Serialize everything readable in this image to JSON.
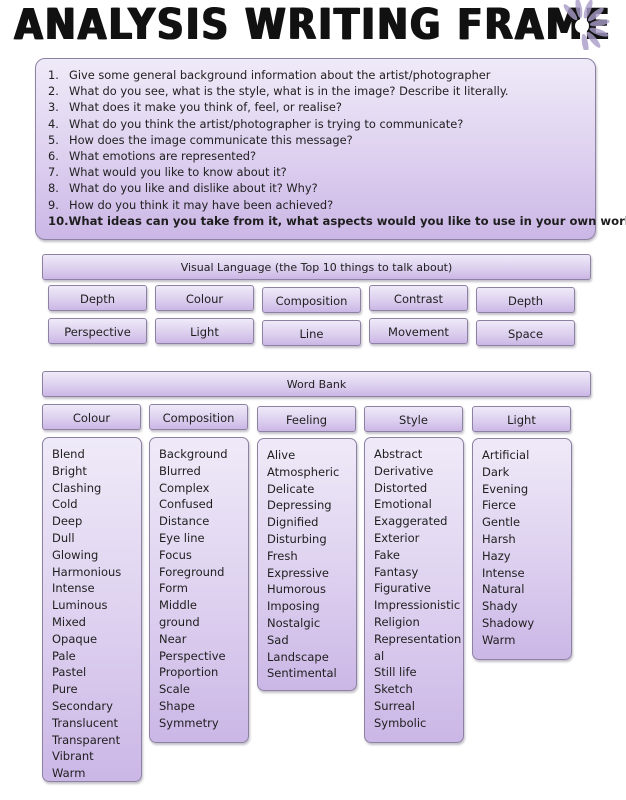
{
  "title": "ANALYSIS WRITING FRAME",
  "decoration": "flower-burst-icon",
  "questions": [
    {
      "num": "1.",
      "text": "Give some general background information about the artist/photographer"
    },
    {
      "num": "2.",
      "text": "What do you see, what is the style, what is in the image?  Describe it literally."
    },
    {
      "num": "3.",
      "text": "What does it make you think of, feel, or realise?"
    },
    {
      "num": "4.",
      "text": "What do you think the artist/photographer is trying to communicate?"
    },
    {
      "num": "5.",
      "text": "How does the image communicate this message?"
    },
    {
      "num": "6.",
      "text": "What emotions are represented?"
    },
    {
      "num": "7.",
      "text": "What would you like to know about it?"
    },
    {
      "num": "8.",
      "text": "What do you like and dislike about it?  Why?"
    },
    {
      "num": "9.",
      "text": "How do you think it may have been achieved?"
    },
    {
      "num": "10.",
      "text": "What ideas can you take from it, what aspects would you like to use in your own work?"
    }
  ],
  "visual_language": {
    "header": "Visual Language (the Top 10 things to talk about)",
    "row1": [
      "Depth",
      "Colour",
      "Composition",
      "Contrast",
      "Depth"
    ],
    "row2": [
      "Perspective",
      "Light",
      "Line",
      "Movement",
      "Space"
    ]
  },
  "word_bank": {
    "header": "Word Bank",
    "columns": [
      {
        "title": "Colour",
        "words": [
          "Blend",
          "Bright",
          "Clashing",
          "Cold",
          "Deep",
          "Dull",
          "Glowing",
          "Harmonious",
          "Intense",
          "Luminous",
          "Mixed",
          "Opaque",
          "Pale",
          "Pastel",
          "Pure",
          "Secondary",
          "Translucent",
          "Transparent",
          "Vibrant",
          "Warm"
        ]
      },
      {
        "title": "Composition",
        "words": [
          "Background",
          "Blurred",
          "Complex",
          "Confused",
          "Distance",
          "Eye line",
          "Focus",
          "Foreground",
          "Form",
          "Middle",
          "ground",
          "Near",
          "Perspective",
          "Proportion",
          "Scale",
          "Shape",
          "Symmetry"
        ]
      },
      {
        "title": "Feeling",
        "words": [
          "Alive",
          "Atmospheric",
          "Delicate",
          "Depressing",
          "Dignified",
          "Disturbing",
          "Fresh",
          "Expressive",
          "Humorous",
          "Imposing",
          "Nostalgic",
          "Sad",
          "Landscape",
          "Sentimental"
        ]
      },
      {
        "title": "Style",
        "words": [
          "Abstract",
          "Derivative",
          "Distorted",
          "Emotional",
          "Exaggerated",
          "Exterior",
          "Fake",
          "Fantasy",
          "Figurative",
          "Impressionistic",
          "Religion",
          "Representation",
          "al",
          "Still life",
          "Sketch",
          "Surreal",
          "Symbolic"
        ]
      },
      {
        "title": "Light",
        "words": [
          "Artificial",
          "Dark",
          "Evening",
          "Fierce",
          "Gentle",
          "Harsh",
          "Hazy",
          "Intense",
          "Natural",
          "Shady",
          "Shadowy",
          "Warm"
        ]
      }
    ]
  },
  "colors": {
    "box_light": "#efeaf8",
    "box_dark": "#cbb7e6",
    "border": "#8e82a2",
    "text": "#1e1e1e"
  }
}
